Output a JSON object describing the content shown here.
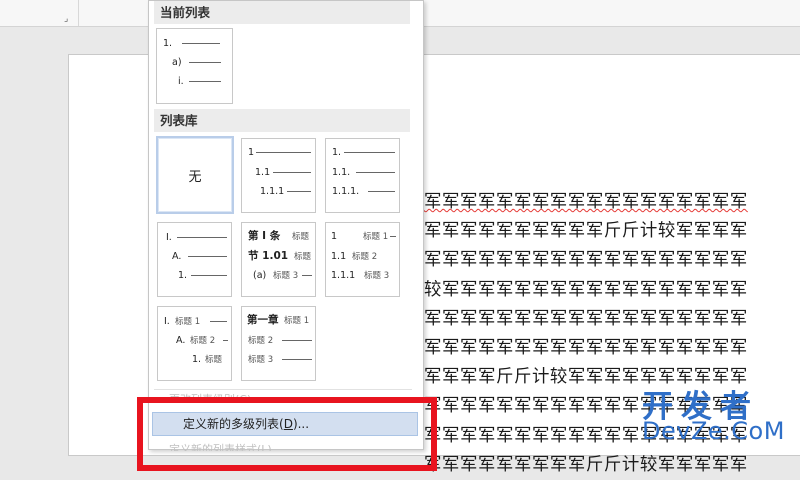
{
  "ribbon": {
    "launcher_icon": "dialog-launcher-icon"
  },
  "menu": {
    "current_header": "当前列表",
    "current_list": {
      "lines": [
        "1.",
        "a)",
        "i."
      ]
    },
    "library_header": "列表库",
    "library": {
      "none_label": "无",
      "tile2": [
        "1",
        "1.1",
        "1.1.1"
      ],
      "tile3": [
        "1.",
        "1.1.",
        "1.1.1."
      ],
      "tile4": [
        "I.",
        "A.",
        "1."
      ],
      "tile5": {
        "l1a": "第 I 条",
        "l1b": "标题",
        "l2a": "节 1.01",
        "l2b": "标题",
        "l3a": "(a)",
        "l3b": "标题 3"
      },
      "tile6": {
        "l1a": "1",
        "l1b": "标题 1",
        "l2a": "1.1",
        "l2b": "标题 2",
        "l3a": "1.1.1",
        "l3b": "标题 3"
      },
      "tile7": {
        "l1a": "I.",
        "l1b": "标题 1",
        "l2a": "A.",
        "l2b": "标题 2",
        "l3a": "1.",
        "l3b": "标题"
      },
      "tile8": {
        "l1a": "第一章",
        "l1b": "标题 1",
        "l2b": "标题 2",
        "l3b": "标题 3"
      }
    },
    "change_level_label": "更改列表级别(C)",
    "define_new_label_pre": "定义新的多级列表(",
    "define_new_label_key": "D",
    "define_new_label_post": ")...",
    "define_style_label": "定义新的列表样式(L)..."
  },
  "document": {
    "lines": [
      "军军军军军军军军军军军军军军军军军军",
      "军军军军军军军军军军斤斤计较军军军军",
      "军军军军军军军军军军军军军军军军军军",
      "较军军军军军军军军军军军军军军军军军",
      "军军军军军军军军军军军军军军军军军军",
      "军军军军军军军军军军军军军军军军军军",
      "军军军军斤斤计较军军军军军军军军军军",
      "军军军军军军军军军军军军军军军军军军",
      "军军军军军军军军军军军军军军军军军军",
      "军军军军军军军军军斤斤计较军军军军军"
    ]
  },
  "watermark": {
    "top": "开发者",
    "bottom": "DevZe.CoM"
  },
  "colors": {
    "highlight": "#e8141f",
    "selected_item": "#d3dff0",
    "watermark": "#2f6fc8"
  }
}
